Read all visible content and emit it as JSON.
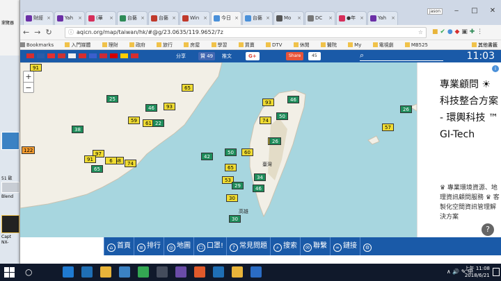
{
  "browser": {
    "url": "aqicn.org/map/taiwan/hk/#@g/23.0635/119.9652/7z",
    "user": "jason",
    "tabs": [
      {
        "label": "財經",
        "color": "#6b2fa6"
      },
      {
        "label": "Yah",
        "color": "#6b2fa6"
      },
      {
        "label": "(華",
        "color": "#d62e5a"
      },
      {
        "label": "台藝",
        "color": "#2e8b57"
      },
      {
        "label": "台藝",
        "color": "#c0392b"
      },
      {
        "label": "Win",
        "color": "#c0392b"
      },
      {
        "label": "今日",
        "color": "#4a90d9"
      },
      {
        "label": "台藝",
        "color": "#4a90d9"
      },
      {
        "label": "Mo",
        "color": "#555555"
      },
      {
        "label": "DC",
        "color": "#777777"
      },
      {
        "label": "●年",
        "color": "#d62e5a"
      },
      {
        "label": "Yah",
        "color": "#6b2fa6"
      }
    ],
    "bookmarks": [
      "Bookmarks",
      "入門媒體",
      "理財",
      "政府",
      "旅行",
      "房屋",
      "學習",
      "買賣",
      "DTV",
      "休閒",
      "醫院",
      "My",
      "電視劇",
      "MB525"
    ],
    "other_bookmarks": "其他書籤"
  },
  "site": {
    "share": {
      "fb": "分享",
      "like": "贊 49",
      "tweet": "推文",
      "gplus": "G+",
      "share": "Share",
      "count": "45"
    },
    "time": "11:03",
    "flags": [
      "#d62e2e",
      "#2a5caa",
      "#e03030",
      "#cc3333",
      "#f0f0f0",
      "#d62e2e",
      "#3a5fcd",
      "#cc2a36",
      "#d40000",
      "#ffcc00",
      "#d62e2e"
    ],
    "nav": [
      {
        "icon": "home-icon",
        "label": "首頁",
        "glyph": "⌂"
      },
      {
        "icon": "ranking-icon",
        "label": "排行",
        "glyph": "≡"
      },
      {
        "icon": "globe-icon",
        "label": "地圖",
        "glyph": "◎"
      },
      {
        "icon": "mask-icon",
        "label": "口罩!",
        "glyph": "☐"
      },
      {
        "icon": "question-icon",
        "label": "常見問題",
        "glyph": "?"
      },
      {
        "icon": "search-icon",
        "label": "搜索",
        "glyph": "⌕"
      },
      {
        "icon": "contact-icon",
        "label": "聯繫",
        "glyph": "✉"
      },
      {
        "icon": "link-icon",
        "label": "鏈接",
        "glyph": "∞"
      },
      {
        "icon": "settings-icon",
        "label": "",
        "glyph": "⚙"
      }
    ]
  },
  "map": {
    "labels": [
      "臺灣",
      "高雄"
    ],
    "markers": [
      {
        "value": "91",
        "level": "y"
      },
      {
        "value": "65",
        "level": "y"
      },
      {
        "value": "25",
        "level": "g"
      },
      {
        "value": "93",
        "level": "y"
      },
      {
        "value": "46",
        "level": "g"
      },
      {
        "value": "59",
        "level": "y"
      },
      {
        "value": "61",
        "level": "y"
      },
      {
        "value": "22",
        "level": "g"
      },
      {
        "value": "38",
        "level": "g"
      },
      {
        "value": "122",
        "level": "o"
      },
      {
        "value": "97",
        "level": "y"
      },
      {
        "value": "91",
        "level": "y"
      },
      {
        "value": "68",
        "level": "y"
      },
      {
        "value": "74",
        "level": "y"
      },
      {
        "value": "65",
        "level": "g"
      },
      {
        "value": "6",
        "level": "y"
      },
      {
        "value": "93",
        "level": "y"
      },
      {
        "value": "46",
        "level": "g"
      },
      {
        "value": "50",
        "level": "g"
      },
      {
        "value": "74",
        "level": "y"
      },
      {
        "value": "55",
        "level": "y"
      },
      {
        "value": "26",
        "level": "g"
      },
      {
        "value": "60",
        "level": "y"
      },
      {
        "value": "50",
        "level": "g"
      },
      {
        "value": "42",
        "level": "g"
      },
      {
        "value": "65",
        "level": "y"
      },
      {
        "value": "53",
        "level": "y"
      },
      {
        "value": "29",
        "level": "g"
      },
      {
        "value": "34",
        "level": "g"
      },
      {
        "value": "46",
        "level": "g"
      },
      {
        "value": "30",
        "level": "y"
      },
      {
        "value": "30",
        "level": "g"
      },
      {
        "value": "57",
        "level": "y"
      },
      {
        "value": "26",
        "level": "g"
      }
    ]
  },
  "ad": {
    "title": "專業顧問 ☀ 科技整合方案 - 環輿科技 ™ GI-Tech",
    "body": "♛ 專業環境資源、地理資訊顧問服務 ♛ 客製化空間資訊管理解決方案",
    "info": "i",
    "help": "?"
  },
  "desktop": {
    "labels": [
      "瀏覽器",
      "51 歐",
      "Blend",
      "Capt",
      "NX-"
    ]
  },
  "taskbar": {
    "clock_time": "上午 11:08",
    "clock_date": "2018/6/21",
    "tray": "∧ 🔊 ✎ 中",
    "app_colors": [
      "#1f7ad1",
      "#1f6fb5",
      "#e8b43a",
      "#3b82c4",
      "#34a853",
      "#444c5c",
      "#6a4ca8",
      "#e05a2b",
      "#1f6fb5",
      "#e8b43a",
      "#2b6cc4"
    ]
  }
}
